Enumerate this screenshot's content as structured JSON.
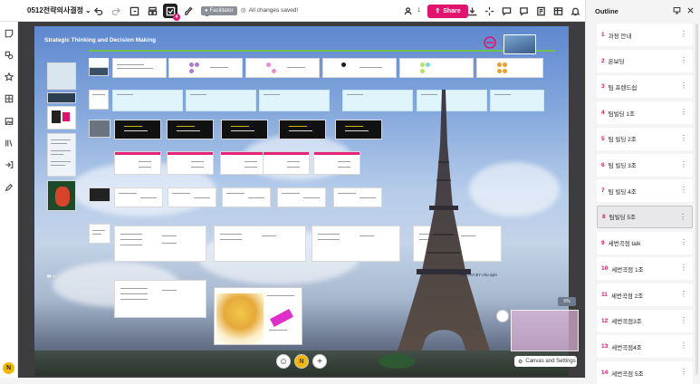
{
  "topbar": {
    "title": "0512전략의사결정",
    "facilitator_label": "Facilitator",
    "saved_status": "All changes saved!",
    "user_count": "1",
    "share_label": "Share",
    "active_tool_badge": "4"
  },
  "board": {
    "title": "Strategic Thinking and Decision Making",
    "photo_credit": "PHOTO BY cho.nijin",
    "zoom": "5%",
    "settings_label": "Canvas and Settings"
  },
  "user": {
    "initial": "N"
  },
  "outline": {
    "title": "Outline",
    "items": [
      {
        "num": "1",
        "label": "과정 안내"
      },
      {
        "num": "2",
        "label": "온보딩"
      },
      {
        "num": "3",
        "label": "팀 프렌드쉽"
      },
      {
        "num": "4",
        "label": "팀빌딩 1조"
      },
      {
        "num": "5",
        "label": "팀 빌딩 2조"
      },
      {
        "num": "6",
        "label": "팀 빌딩 3조"
      },
      {
        "num": "7",
        "label": "팀 빌딩 4조"
      },
      {
        "num": "8",
        "label": "팀빌딩 5조"
      },
      {
        "num": "9",
        "label": "세번곡점 talk"
      },
      {
        "num": "10",
        "label": "세번곡점 1조"
      },
      {
        "num": "11",
        "label": "세번곡점 2조"
      },
      {
        "num": "12",
        "label": "세번곡점3조"
      },
      {
        "num": "13",
        "label": "세번곡점4조"
      },
      {
        "num": "14",
        "label": "세번곡점 5조"
      }
    ],
    "selected_index": 7
  },
  "colors": {
    "accent": "#e2136e",
    "title_line": "#6fbf4b",
    "avatar": "#f5b800"
  }
}
